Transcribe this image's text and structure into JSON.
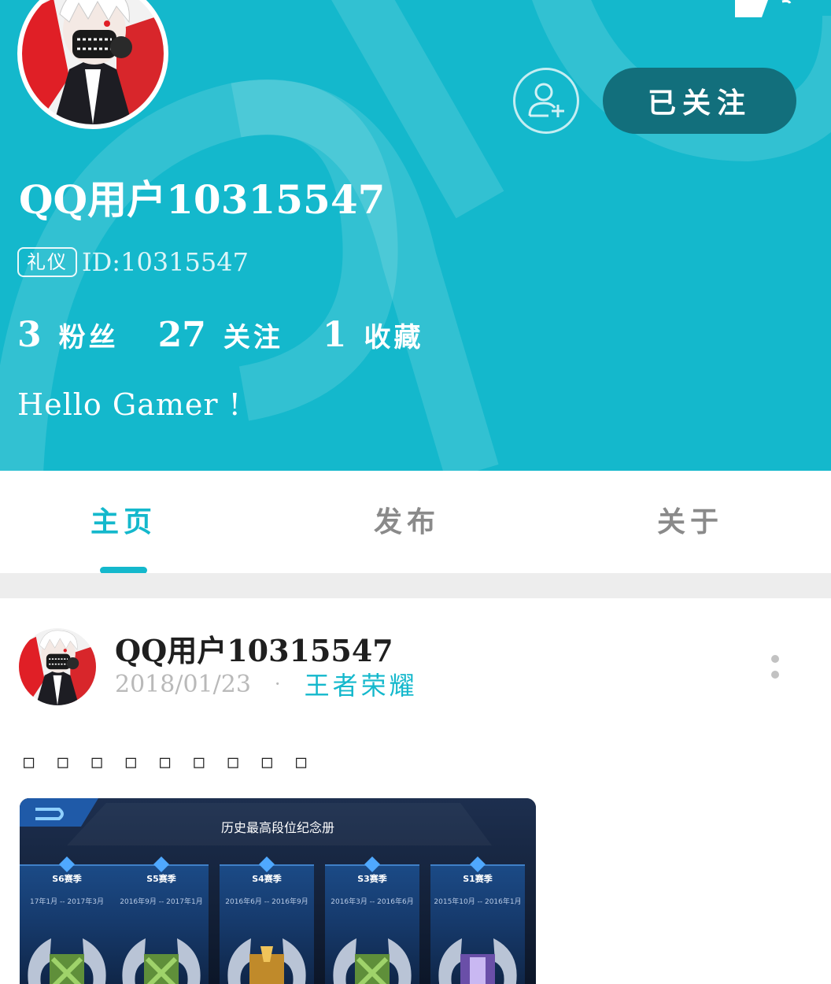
{
  "colors": {
    "accent": "#14b8cc",
    "follow_button": "#126f7c",
    "divider": "#ededed",
    "muted_text": "#b9b9b9"
  },
  "header": {
    "username": "QQ用户10315547",
    "role_badge": "礼仪",
    "user_id": "ID:10315547",
    "follow_label": "已关注",
    "stats": [
      {
        "value": "3",
        "label": "粉丝"
      },
      {
        "value": "27",
        "label": "关注"
      },
      {
        "value": "1",
        "label": "收藏"
      }
    ],
    "bio": "Hello Gamer !"
  },
  "tabs": [
    {
      "label": "主页",
      "active": true
    },
    {
      "label": "发布",
      "active": false
    },
    {
      "label": "关于",
      "active": false
    }
  ],
  "post": {
    "author": "QQ用户10315547",
    "date": "2018/01/23",
    "separator": "·",
    "game": "王者荣耀",
    "text": "□□□□□□□□□",
    "image": {
      "title": "历史最高段位纪念册",
      "seasons": [
        {
          "name": "S6赛季",
          "range": "17年1月 -- 2017年3月",
          "tier": "green"
        },
        {
          "name": "S5赛季",
          "range": "2016年9月 -- 2017年1月",
          "tier": "green"
        },
        {
          "name": "S4赛季",
          "range": "2016年6月 -- 2016年9月",
          "tier": "gold"
        },
        {
          "name": "S3赛季",
          "range": "2016年3月 -- 2016年6月",
          "tier": "green"
        },
        {
          "name": "S1赛季",
          "range": "2015年10月 -- 2016年1月",
          "tier": "purple"
        }
      ]
    }
  }
}
